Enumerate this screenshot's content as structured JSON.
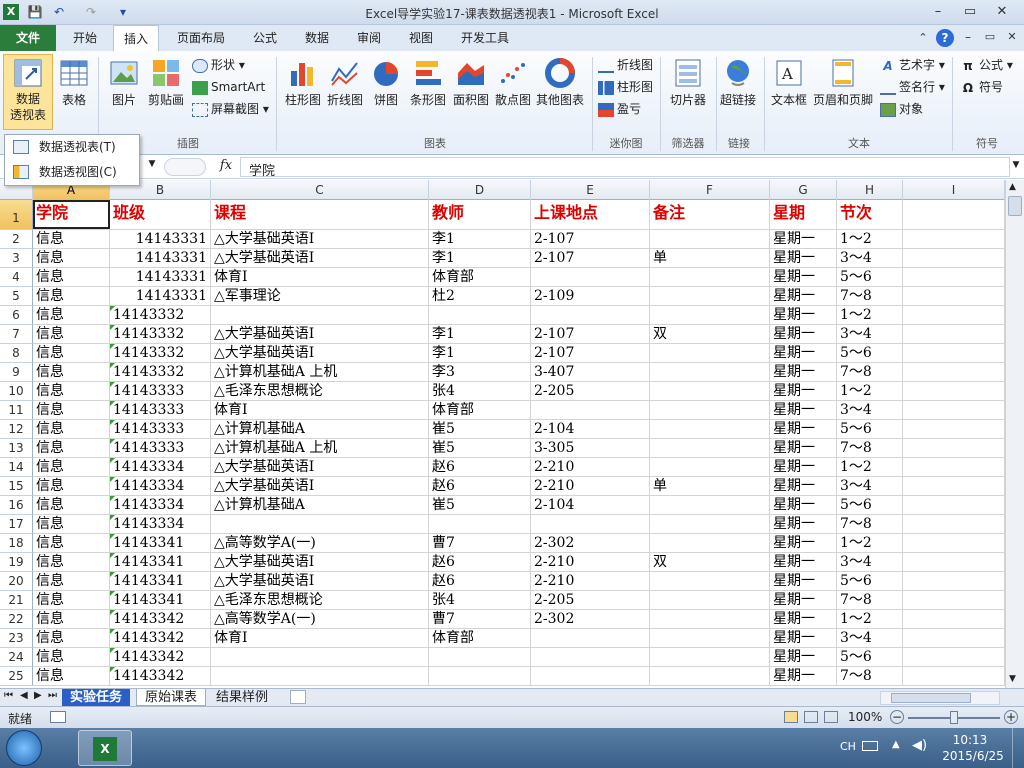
{
  "window": {
    "title": "Excel导学实验17-课表数据透视表1 - Microsoft Excel",
    "minimize": "–",
    "restore": "▭",
    "close": "✕"
  },
  "qat": {
    "save": "💾",
    "undo": "↶",
    "redo": "↷",
    "more": "▾"
  },
  "tabs": [
    "文件",
    "开始",
    "插入",
    "页面布局",
    "公式",
    "数据",
    "审阅",
    "视图",
    "开发工具"
  ],
  "ribbon": {
    "pivot_label": "数据\n透视表",
    "table": "表格",
    "picture": "图片",
    "clipart": "剪贴画",
    "shapes": "形状",
    "smartart": "SmartArt",
    "screenshot": "屏幕截图",
    "column": "柱形图",
    "line": "折线图",
    "pie": "饼图",
    "bar": "条形图",
    "area": "面积图",
    "scatter": "散点图",
    "other": "其他图表",
    "spark_line": "折线图",
    "spark_col": "柱形图",
    "spark_wl": "盈亏",
    "slicer": "切片器",
    "hyperlink": "超链接",
    "textbox": "文本框",
    "headerfooter": "页眉和页脚",
    "wordart": "艺术字",
    "signature": "签名行",
    "object": "对象",
    "equation": "公式",
    "symbol": "符号",
    "groups": {
      "illustrations": "插图",
      "charts": "图表",
      "sparklines": "迷你图",
      "filter": "筛选器",
      "links": "链接",
      "text": "文本",
      "symbols": "符号"
    }
  },
  "dropdown": {
    "items": [
      "数据透视表(T)",
      "数据透视图(C)"
    ]
  },
  "formula_bar": {
    "fx": "fx",
    "value": "学院"
  },
  "columns": [
    "A",
    "B",
    "C",
    "D",
    "E",
    "F",
    "G",
    "H",
    "I"
  ],
  "sheet": {
    "header": [
      "学院",
      "班级",
      "课程",
      "教师",
      "上课地点",
      "备注",
      "星期",
      "节次"
    ],
    "rows": [
      [
        "信息",
        "14143331",
        "△大学基础英语Ⅰ",
        "李1",
        "2-107",
        "",
        "星期一",
        "1～2"
      ],
      [
        "信息",
        "14143331",
        "△大学基础英语Ⅰ",
        "李1",
        "2-107",
        "单",
        "星期一",
        "3～4"
      ],
      [
        "信息",
        "14143331",
        "体育Ⅰ",
        "体育部",
        "",
        "",
        "星期一",
        "5～6"
      ],
      [
        "信息",
        "14143331",
        "△军事理论",
        "杜2",
        "2-109",
        "",
        "星期一",
        "7～8"
      ],
      [
        "信息",
        "14143332",
        "",
        "",
        "",
        "",
        "星期一",
        "1～2"
      ],
      [
        "信息",
        "14143332",
        "△大学基础英语Ⅰ",
        "李1",
        "2-107",
        "双",
        "星期一",
        "3～4"
      ],
      [
        "信息",
        "14143332",
        "△大学基础英语Ⅰ",
        "李1",
        "2-107",
        "",
        "星期一",
        "5～6"
      ],
      [
        "信息",
        "14143332",
        "△计算机基础A 上机",
        "李3",
        "3-407",
        "",
        "星期一",
        "7～8"
      ],
      [
        "信息",
        "14143333",
        "△毛泽东思想概论",
        "张4",
        "2-205",
        "",
        "星期一",
        "1～2"
      ],
      [
        "信息",
        "14143333",
        "体育Ⅰ",
        "体育部",
        "",
        "",
        "星期一",
        "3～4"
      ],
      [
        "信息",
        "14143333",
        "△计算机基础A",
        "崔5",
        "2-104",
        "",
        "星期一",
        "5～6"
      ],
      [
        "信息",
        "14143333",
        "△计算机基础A 上机",
        "崔5",
        "3-305",
        "",
        "星期一",
        "7～8"
      ],
      [
        "信息",
        "14143334",
        "△大学基础英语Ⅰ",
        "赵6",
        "2-210",
        "",
        "星期一",
        "1～2"
      ],
      [
        "信息",
        "14143334",
        "△大学基础英语Ⅰ",
        "赵6",
        "2-210",
        "单",
        "星期一",
        "3～4"
      ],
      [
        "信息",
        "14143334",
        "△计算机基础A",
        "崔5",
        "2-104",
        "",
        "星期一",
        "5～6"
      ],
      [
        "信息",
        "14143334",
        "",
        "",
        "",
        "",
        "星期一",
        "7～8"
      ],
      [
        "信息",
        "14143341",
        "△高等数学A(一)",
        "曹7",
        "2-302",
        "",
        "星期一",
        "1～2"
      ],
      [
        "信息",
        "14143341",
        "△大学基础英语Ⅰ",
        "赵6",
        "2-210",
        "双",
        "星期一",
        "3～4"
      ],
      [
        "信息",
        "14143341",
        "△大学基础英语Ⅰ",
        "赵6",
        "2-210",
        "",
        "星期一",
        "5～6"
      ],
      [
        "信息",
        "14143341",
        "△毛泽东思想概论",
        "张4",
        "2-205",
        "",
        "星期一",
        "7～8"
      ],
      [
        "信息",
        "14143342",
        "△高等数学A(一)",
        "曹7",
        "2-302",
        "",
        "星期一",
        "1～2"
      ],
      [
        "信息",
        "14143342",
        "体育Ⅰ",
        "体育部",
        "",
        "",
        "星期一",
        "3～4"
      ],
      [
        "信息",
        "14143342",
        "",
        "",
        "",
        "",
        "星期一",
        "5～6"
      ],
      [
        "信息",
        "14143342",
        "",
        "",
        "",
        "",
        "星期一",
        "7～8"
      ]
    ]
  },
  "sheet_tabs": [
    "实验任务",
    "原始课表",
    "结果样例"
  ],
  "status": {
    "ready": "就绪",
    "zoom": "100%"
  },
  "taskbar": {
    "ime": "CH",
    "time": "10:13",
    "date": "2015/6/25"
  }
}
